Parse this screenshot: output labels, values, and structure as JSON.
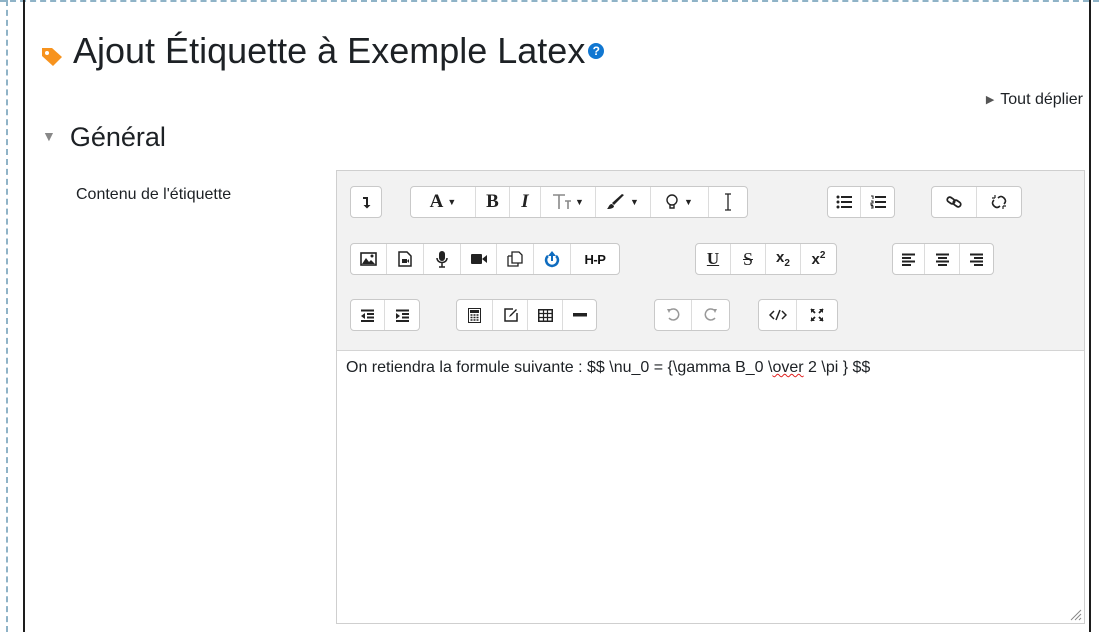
{
  "page": {
    "title": "Ajout Étiquette à Exemple Latex",
    "help_icon": "?",
    "expand_all": "Tout déplier",
    "section": "Général",
    "field_label": "Contenu de l'étiquette"
  },
  "toolbar": {
    "rows": [
      [
        "collapse-toolbar",
        "font-color",
        "bold",
        "italic",
        "font-size",
        "brush",
        "lightbulb",
        "text-cursor",
        "unordered-list",
        "ordered-list",
        "link",
        "unlink"
      ],
      [
        "image",
        "media",
        "microphone",
        "video",
        "manage-files",
        "upload",
        "h5p",
        "underline",
        "strikethrough",
        "subscript",
        "superscript",
        "align-left",
        "align-center",
        "align-right"
      ],
      [
        "outdent",
        "indent",
        "calculator",
        "edit",
        "table",
        "horizontal-rule",
        "undo",
        "redo",
        "html-source",
        "fullscreen"
      ]
    ],
    "labels": {
      "bold": "B",
      "italic": "I",
      "underline": "U",
      "strike": "S",
      "h5p": "H-P",
      "font": "A",
      "sub_base": "x",
      "sub_index": "2",
      "sup_base": "x",
      "sup_index": "2"
    }
  },
  "content": {
    "text_before": "On retiendra la formule suivante : $$ \\nu_0 = {\\gamma B_0 \\",
    "text_misspelled": "over",
    "text_after": " 2 \\pi } $$"
  },
  "colors": {
    "accent_orange": "#f7931e",
    "help_blue": "#1177d1",
    "upload_blue": "#0f6cbf"
  }
}
